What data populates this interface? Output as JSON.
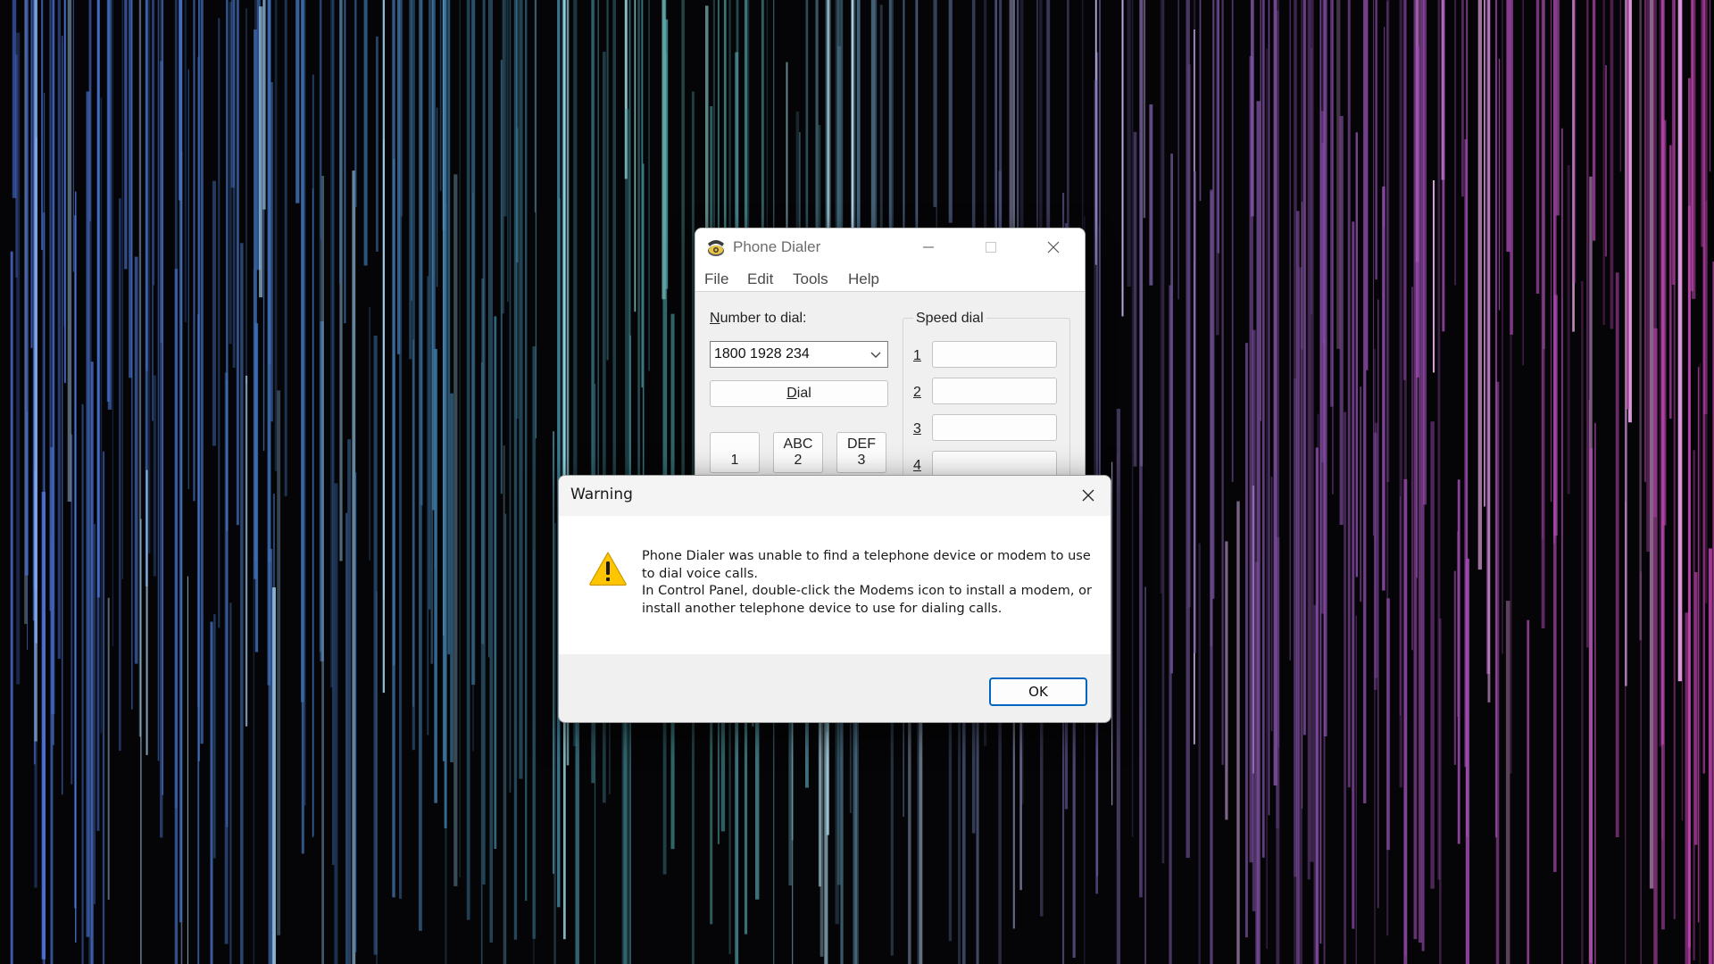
{
  "dialer": {
    "title": "Phone Dialer",
    "menu": [
      "File",
      "Edit",
      "Tools",
      "Help"
    ],
    "number_label_key": "N",
    "number_label_rest": "umber to dial:",
    "number_value": "1800 1928 234",
    "dial_key": "D",
    "dial_rest": "ial",
    "keys": [
      {
        "letters": "",
        "digit": "1"
      },
      {
        "letters": "ABC",
        "digit": "2"
      },
      {
        "letters": "DEF",
        "digit": "3"
      }
    ],
    "speed_dial_label": "Speed dial",
    "speed_dial_numbers": [
      "1",
      "2",
      "3",
      "4"
    ]
  },
  "warning": {
    "title": "Warning",
    "message_line1": "Phone Dialer was unable to find a telephone device or modem to use to dial voice calls.",
    "message_line2": "In Control Panel, double-click the Modems icon to install a modem, or install another telephone device to use for dialing calls.",
    "ok_label": "OK"
  },
  "icons": {
    "app": "phone-dialer-app-icon",
    "warning": "warning-triangle-icon",
    "close": "close-icon",
    "minimize": "minimize-icon",
    "maximize": "maximize-icon",
    "dropdown": "chevron-down-icon"
  },
  "colors": {
    "accent": "#0067c0",
    "warning_yellow": "#ffc600",
    "desktop_bg": "#050507"
  }
}
